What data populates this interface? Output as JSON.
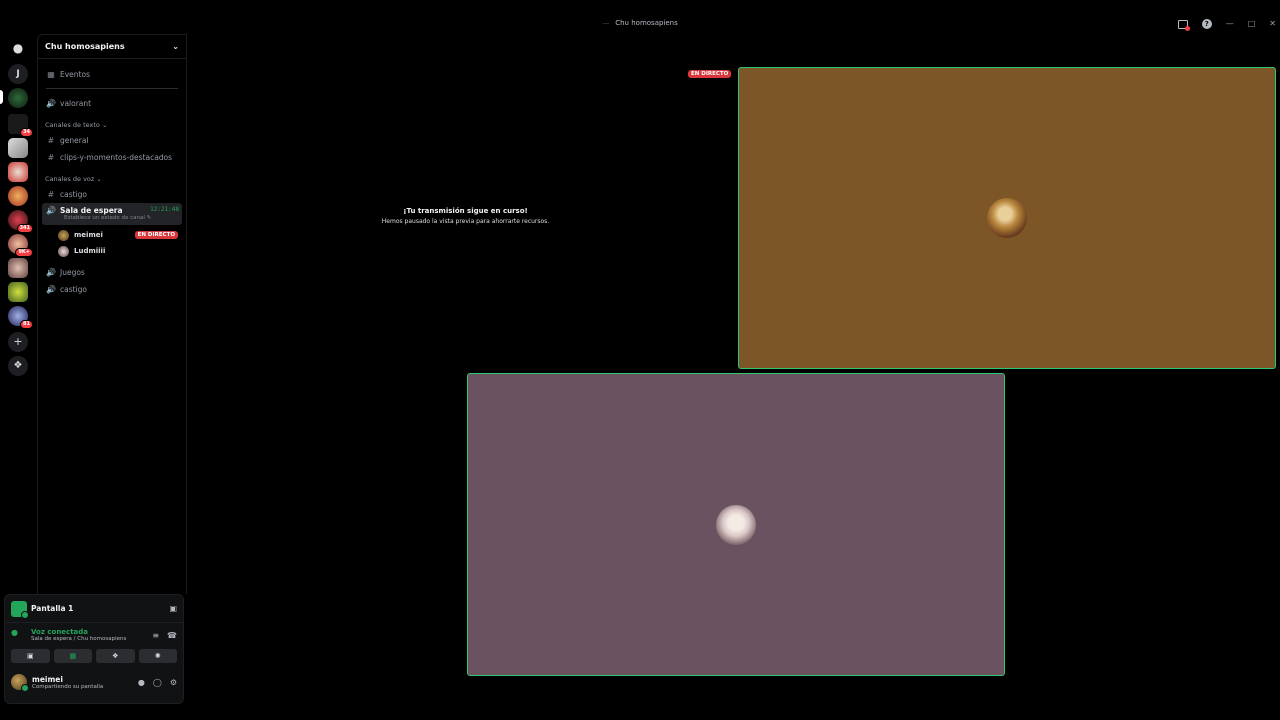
{
  "window": {
    "title": "Chu homosapiens",
    "controls": [
      "—",
      "□",
      "✕"
    ]
  },
  "guild_rail": {
    "items": [
      {
        "name": "discord-home",
        "badge": ""
      },
      {
        "name": "J",
        "badge": ""
      },
      {
        "name": "server-1",
        "badge": ""
      },
      {
        "name": "server-2",
        "badge": "34"
      },
      {
        "name": "server-3",
        "badge": ""
      },
      {
        "name": "server-4",
        "badge": ""
      },
      {
        "name": "server-5",
        "badge": ""
      },
      {
        "name": "server-6",
        "badge": "341"
      },
      {
        "name": "server-7",
        "badge": "9K+"
      },
      {
        "name": "server-8",
        "badge": ""
      },
      {
        "name": "server-9",
        "badge": ""
      },
      {
        "name": "server-10",
        "badge": "81"
      }
    ]
  },
  "server": {
    "name": "Chu homosapiens",
    "events_label": "Eventos",
    "voice_top": "valorant",
    "text_category": "Canales de texto",
    "text_channels": [
      "general",
      "clips-y-momentos-destacados"
    ],
    "voice_category": "Canales de voz",
    "castigo_text": "castigo",
    "waiting_room": {
      "name": "Sala de espera",
      "timer": "12:21:48",
      "status_hint": "Establece un estado de canal",
      "users": [
        {
          "name": "meimei",
          "live": "EN DIRECTO"
        },
        {
          "name": "Ludmiiii",
          "live": ""
        }
      ]
    },
    "voice_others": [
      "Juegos",
      "castigo"
    ]
  },
  "panel": {
    "screen_label": "Pantalla 1",
    "voice_title": "Voz conectada",
    "voice_sub": "Sala de espera / Chu homosapiens",
    "user_name": "meimei",
    "user_status": "Compartiendo su pantalla"
  },
  "stage": {
    "notice_title": "¡Tu transmisión sigue en curso!",
    "notice_body": "Hemos pausado la vista previa para ahorrarte recursos.",
    "live_tag": "EN DIRECTO",
    "tile_colors": [
      "#7d5628",
      "#6b5260"
    ]
  }
}
